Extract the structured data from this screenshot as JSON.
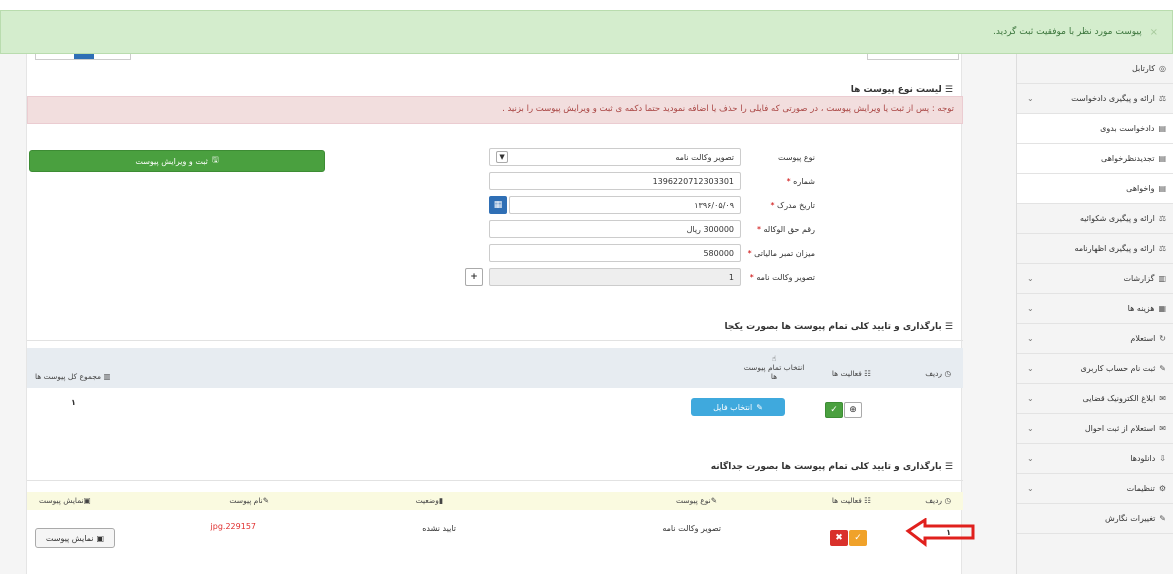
{
  "notification": {
    "text": "پیوست مورد نظر با موفقیت ثبت گردید.",
    "close": "×"
  },
  "sidebar": {
    "items": [
      {
        "label": "کارتابل",
        "icon": "dashboard-icon",
        "chevron": false,
        "sub": false
      },
      {
        "label": "ارائه و پیگیری دادخواست",
        "icon": "scale-icon",
        "chevron": true,
        "sub": false
      },
      {
        "label": "دادخواست بدوی",
        "icon": "doc-icon",
        "chevron": false,
        "sub": true
      },
      {
        "label": "تجدیدنظرخواهی",
        "icon": "doc-icon",
        "chevron": false,
        "sub": true
      },
      {
        "label": "واخواهی",
        "icon": "doc-icon",
        "chevron": false,
        "sub": true
      },
      {
        "label": "ارائه و پیگیری شکوائیه",
        "icon": "scale-icon",
        "chevron": false,
        "sub": false
      },
      {
        "label": "ارائه و پیگیری اظهارنامه",
        "icon": "scale-icon",
        "chevron": false,
        "sub": false
      },
      {
        "label": "گزارشات",
        "icon": "chart-icon",
        "chevron": true,
        "sub": false
      },
      {
        "label": "هزینه ها",
        "icon": "calc-icon",
        "chevron": true,
        "sub": false
      },
      {
        "label": "استعلام",
        "icon": "refresh-icon",
        "chevron": true,
        "sub": false
      },
      {
        "label": "ثبت نام حساب کاربری",
        "icon": "edit-icon",
        "chevron": true,
        "sub": false
      },
      {
        "label": "ابلاغ الکترونیک قضایی",
        "icon": "mail-icon",
        "chevron": true,
        "sub": false
      },
      {
        "label": "استعلام از ثبت احوال",
        "icon": "mail-icon",
        "chevron": true,
        "sub": false
      },
      {
        "label": "دانلودها",
        "icon": "download-icon",
        "chevron": true,
        "sub": false
      },
      {
        "label": "تنظیمات",
        "icon": "gear-icon",
        "chevron": true,
        "sub": false
      },
      {
        "label": "تغییرات نگارش",
        "icon": "pencil-icon",
        "chevron": false,
        "sub": false
      }
    ]
  },
  "section1": {
    "title": "لیست نوع پیوست ها",
    "warning": "توجه : پس از ثبت یا ویرایش پیوست ، در صورتی که فایلی را حذف یا اضافه نمودید حتما دکمه ی ثبت و ویرایش پیوست را بزنید ."
  },
  "form": {
    "type": {
      "label": "نوع پیوست",
      "value": "تصویر وکالت نامه"
    },
    "number": {
      "label": "شماره",
      "value": "1396220712303301"
    },
    "date": {
      "label": "تاریخ مدرک",
      "value": "۱۳۹۶/۰۵/۰۹"
    },
    "fee": {
      "label": "رقم حق الوکاله",
      "value": "300000 ریال"
    },
    "tax": {
      "label": "میزان تمبر مالیاتی",
      "value": "580000"
    },
    "image": {
      "label": "تصویر وکالت نامه",
      "value": "1"
    },
    "submit_label": "ثبت و ویرایش پیوست",
    "req": "*"
  },
  "section2": {
    "title": "بارگذاری و تایید کلی تمام پیوست ها بصورت یکجا",
    "headers": {
      "row": "ردیف",
      "actions": "فعالیت ها",
      "select_all_1": "انتخاب تمام پیوست",
      "select_all_2": "ها",
      "total": "مجموع کل پیوست ها"
    },
    "total_value": "۱",
    "select_file_label": "انتخاب فایل"
  },
  "section3": {
    "title": "بارگذاری و تایید کلی تمام پیوست ها بصورت جداگانه",
    "headers": {
      "row": "ردیف",
      "actions": "فعالیت ها",
      "type": "نوع پیوست",
      "status": "وضعیت",
      "name": "نام پیوست",
      "view": "نمایش پیوست"
    },
    "rows": [
      {
        "row": "۱",
        "type": "تصویر وکالت نامه",
        "status": "تایید نشده",
        "name": "jpg.229157",
        "view_label": "نمایش پیوست"
      }
    ]
  },
  "colors": {
    "green": "#4aa03f",
    "blue": "#3fa9dd",
    "red": "#d9312b",
    "orange": "#f0a22a",
    "name_red": "#e03030"
  }
}
